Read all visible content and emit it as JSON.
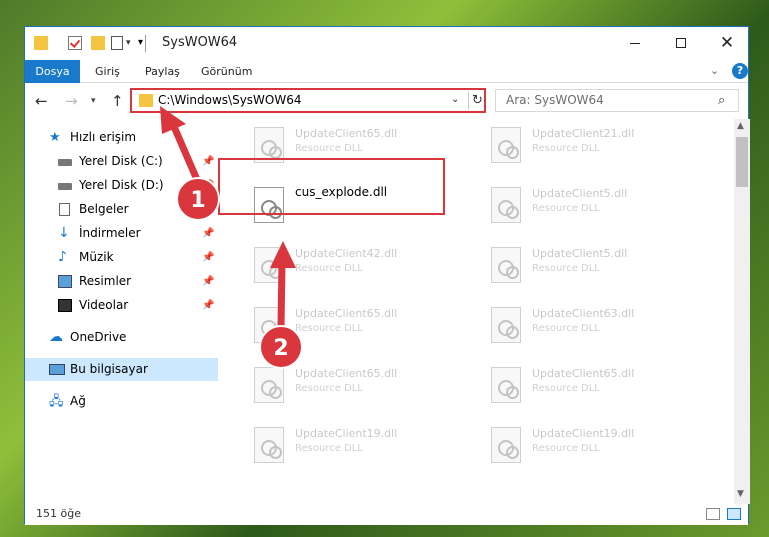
{
  "window": {
    "title": "SysWOW64"
  },
  "ribbon": {
    "tabs": [
      "Dosya",
      "Giriş",
      "Paylaş",
      "Görünüm"
    ],
    "help": "?"
  },
  "address": {
    "path": "C:\\Windows\\SysWOW64"
  },
  "search": {
    "placeholder": "Ara: SysWOW64"
  },
  "sidebar": {
    "items": [
      {
        "label": "Hızlı erişim",
        "icon": "star-icon",
        "pinned": false
      },
      {
        "label": "Yerel Disk (C:)",
        "icon": "drive-icon",
        "pinned": true
      },
      {
        "label": "Yerel Disk (D:)",
        "icon": "drive-icon",
        "pinned": true
      },
      {
        "label": "Belgeler",
        "icon": "documents-icon",
        "pinned": true
      },
      {
        "label": "İndirmeler",
        "icon": "download-icon",
        "pinned": true
      },
      {
        "label": "Müzik",
        "icon": "music-icon",
        "pinned": true
      },
      {
        "label": "Resimler",
        "icon": "pictures-icon",
        "pinned": true
      },
      {
        "label": "Videolar",
        "icon": "video-icon",
        "pinned": true
      },
      {
        "label": "OneDrive",
        "icon": "cloud-icon",
        "pinned": false
      },
      {
        "label": "Bu bilgisayar",
        "icon": "computer-icon",
        "pinned": false,
        "selected": true
      },
      {
        "label": "Ağ",
        "icon": "network-icon",
        "pinned": false
      }
    ]
  },
  "files": [
    {
      "name": "UpdateClient65.dll",
      "type": "Resource DLL"
    },
    {
      "name": "UpdateClient21.dll",
      "type": "Resource DLL"
    },
    {
      "name": "cus_explode.dll",
      "type": "",
      "highlight": true
    },
    {
      "name": "UpdateClient5.dll",
      "type": "Resource DLL"
    },
    {
      "name": "UpdateClient42.dll",
      "type": "Resource DLL"
    },
    {
      "name": "UpdateClient5.dll",
      "type": "Resource DLL"
    },
    {
      "name": "UpdateClient65.dll",
      "type": "Resource DLL"
    },
    {
      "name": "UpdateClient63.dll",
      "type": "Resource DLL"
    },
    {
      "name": "UpdateClient65.dll",
      "type": "Resource DLL"
    },
    {
      "name": "UpdateClient65.dll",
      "type": "Resource DLL"
    },
    {
      "name": "UpdateClient19.dll",
      "type": "Resource DLL"
    },
    {
      "name": "UpdateClient19.dll",
      "type": "Resource DLL"
    }
  ],
  "status": {
    "count": "151 öğe"
  },
  "annotations": {
    "step1": "1",
    "step2": "2"
  },
  "colors": {
    "accent": "#1979ca",
    "highlight": "#d9363e"
  }
}
